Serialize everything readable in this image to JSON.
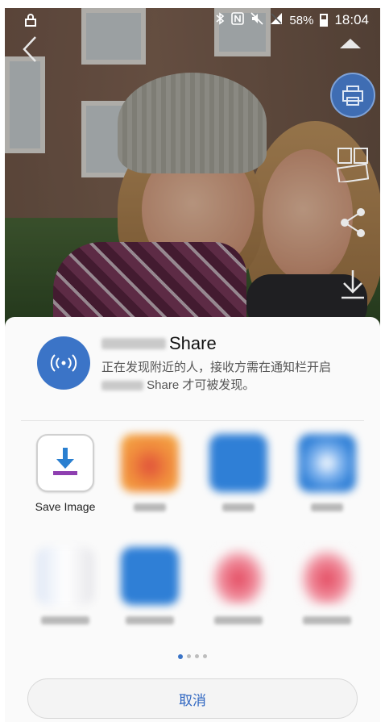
{
  "status_bar": {
    "battery": "58%",
    "time": "18:04"
  },
  "photo_toolbar": {
    "icons": [
      "back-icon",
      "collapse-up-icon",
      "print-icon",
      "collage-icon",
      "share-icon",
      "download-icon"
    ]
  },
  "huawei_share": {
    "title_suffix": "Share",
    "description_line1": "正在发现附近的人，接收方需在通知栏开启",
    "description_line2": "Share 才可被发现。"
  },
  "apps": [
    {
      "label": "Save Image",
      "icon": "save-image-icon"
    },
    {
      "label": "",
      "icon": "app-icon"
    },
    {
      "label": "",
      "icon": "app-icon"
    },
    {
      "label": "",
      "icon": "app-icon"
    },
    {
      "label": "",
      "icon": "app-icon"
    },
    {
      "label": "",
      "icon": "app-icon"
    },
    {
      "label": "",
      "icon": "app-icon"
    },
    {
      "label": "",
      "icon": "app-icon"
    }
  ],
  "pagination": {
    "pages": 4,
    "current": 1
  },
  "cancel_label": "取消",
  "colors": {
    "accent": "#3b74c7",
    "cancel_text": "#2f66c1"
  }
}
